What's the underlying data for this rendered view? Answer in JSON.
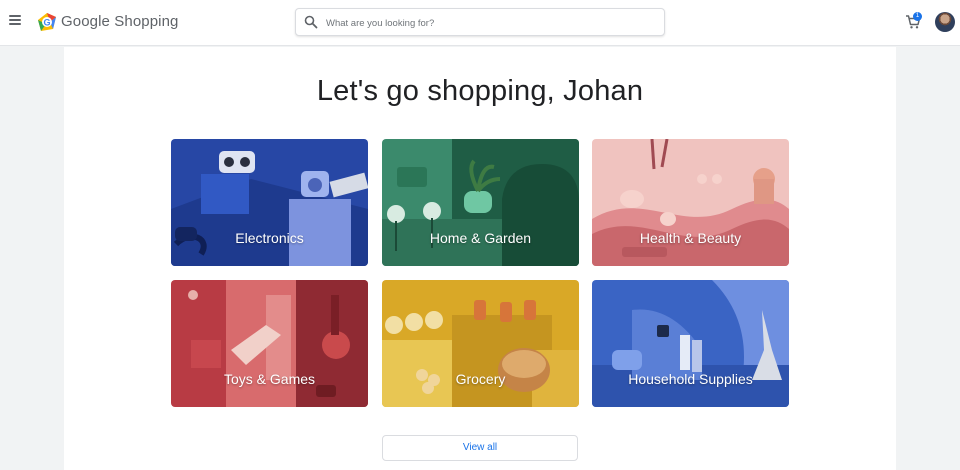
{
  "header": {
    "brand_google": "Google",
    "brand_shopping": "Shopping",
    "search_placeholder": "What are you looking for?",
    "cart_count": "1"
  },
  "main": {
    "greeting": "Let's go shopping, Johan",
    "categories": [
      {
        "label": "Electronics"
      },
      {
        "label": "Home & Garden"
      },
      {
        "label": "Health & Beauty"
      },
      {
        "label": "Toys & Games"
      },
      {
        "label": "Grocery"
      },
      {
        "label": "Household Supplies"
      }
    ],
    "view_all_label": "View all"
  },
  "colors": {
    "accent": "#1a73e8",
    "electronics": "#2747a5",
    "home_garden": "#2e7a5f",
    "health_beauty": "#e8a6a6",
    "toys_games": "#b83b44",
    "grocery": "#d9a827",
    "household": "#3a64c4"
  }
}
